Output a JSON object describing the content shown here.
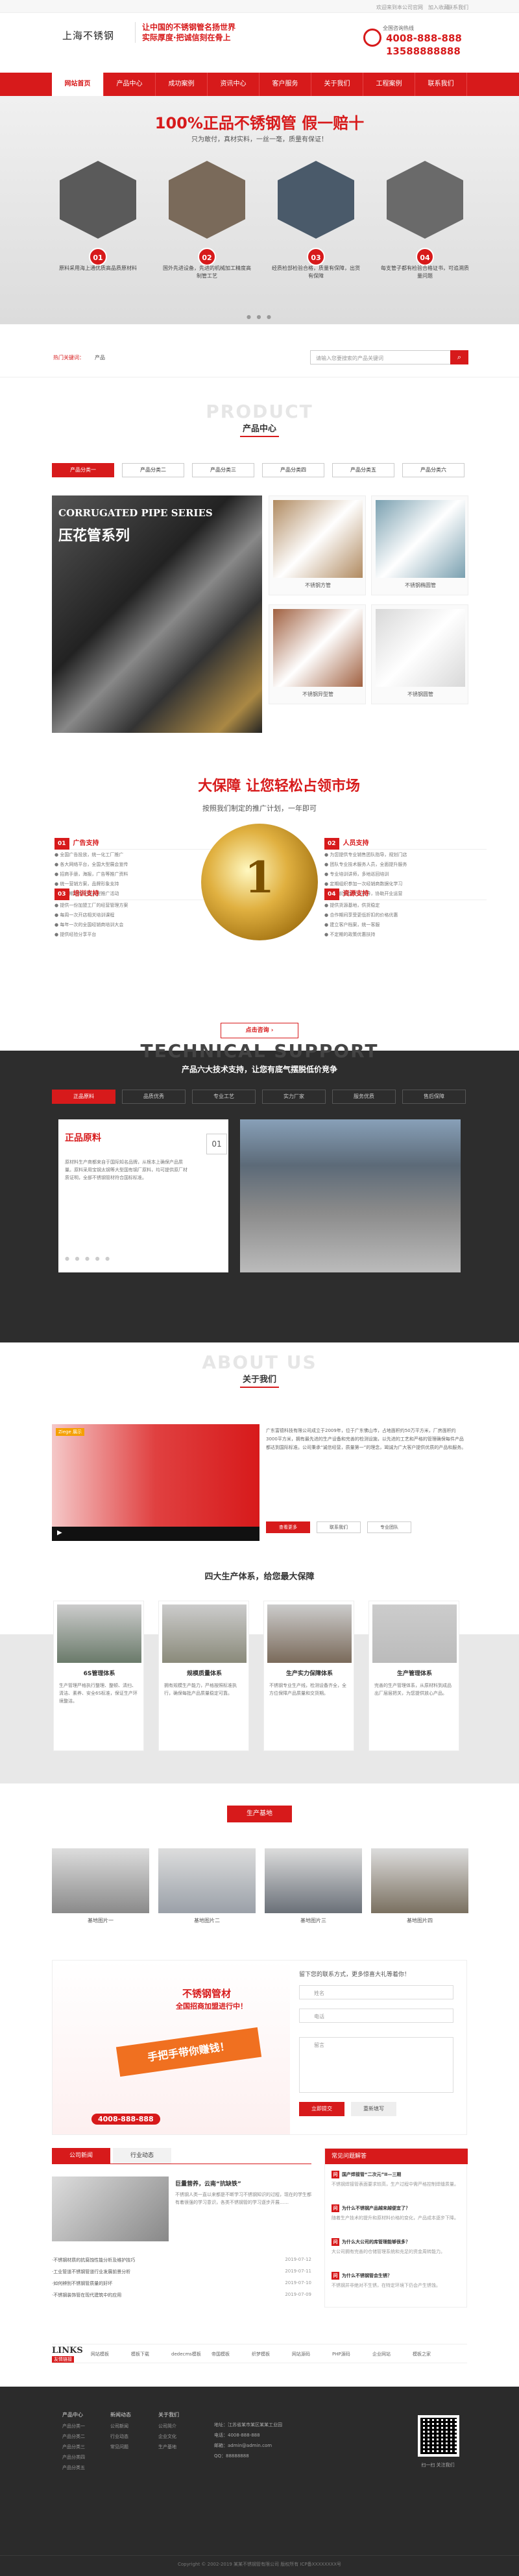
{
  "topbar": {
    "welcome": "欢迎来到本公司官网",
    "collect": "加入收藏",
    "contact": "联系我们"
  },
  "header": {
    "logo": "上海不锈钢",
    "slogan1": "让中国的不锈钢管名扬世界",
    "slogan2": "实际厚度·把诚信刻在骨上",
    "hotline_label": "全国咨询热线",
    "hotline1": "4008-888-888",
    "hotline2": "13588888888"
  },
  "nav": [
    "网站首页",
    "产品中心",
    "成功案例",
    "资讯中心",
    "客户服务",
    "关于我们",
    "工程案例",
    "联系我们"
  ],
  "banner": {
    "title": "100%正品不锈钢管 假一赔十",
    "subtitle": "只为敢付，真材实料，一丝一毫，质量有保证！",
    "items": [
      {
        "num": "01",
        "text": "原料采用海上通优质高品质原材料"
      },
      {
        "num": "02",
        "text": "国外先进设备，先进的机械加工精度高制管工艺"
      },
      {
        "num": "03",
        "text": "经质检部检验合格，质量有保障，出货有保障"
      },
      {
        "num": "04",
        "text": "每支管子都有检验合格证书，可追溯质量问题"
      }
    ],
    "dots": "● ● ●"
  },
  "search": {
    "hot_label": "热门关键词：",
    "hot_item": "产品",
    "placeholder": "请输入您要搜索的产品关键词"
  },
  "products": {
    "en": "PRODUCT",
    "cn": "产品中心",
    "tabs": [
      "产品分类一",
      "产品分类二",
      "产品分类三",
      "产品分类四",
      "产品分类五",
      "产品分类六"
    ],
    "feature_en": "CORRUGATED PIPE SERIES",
    "feature_cn": "压花管系列",
    "thumbs": [
      "不锈钢方管",
      "不锈钢椭圆管",
      "不锈钢异型管",
      "不锈钢圆管"
    ],
    "thumb_colors": [
      "#b08a60",
      "#7aa0b0",
      "#a06040",
      "#d8d8d8"
    ]
  },
  "advantage": {
    "title": "大保障 让您轻松占领市场",
    "subtitle": "按照我们制定的推广计划，一年即可",
    "blocks": [
      {
        "num": "01",
        "head": "广告支持",
        "lines": [
          "全国广告投放，统一化工厂推广",
          "各大网络平台，全国大型展会宣传",
          "招商手册，海报，广告等推广资料",
          "统一营销方案，品牌形象支持",
          "不定期组织全国大型推广活动"
        ]
      },
      {
        "num": "02",
        "head": "人员支持",
        "lines": [
          "为您提供专业销售团队指导，规划门店",
          "团队专业技术服务人员，全面提升服务",
          "专业培训讲师，多地巡回培训",
          "定期组织参加一次经销商数据化学习",
          "开业前后派专人指导，协助开业运营"
        ]
      },
      {
        "num": "03",
        "head": "培训支持",
        "lines": [
          "提供一份加盟工厂的经营管理方案",
          "每周一次开店相关培训课程",
          "每年一次的全国经销商培训大会",
          "提供经验分享平台"
        ]
      },
      {
        "num": "04",
        "head": "资源支持",
        "lines": [
          "提供货源基地，供货稳定",
          "合作期间享受更低折扣的价格优惠",
          "建立客户档案，统一客服",
          "不定期的政策优惠扶持"
        ]
      }
    ],
    "coin_num": "1",
    "button": "点击咨询 ›"
  },
  "tech": {
    "en": "TECHNICAL SUPPORT",
    "cn": "产品六大技术支持，让您有底气摆脱低价竞争",
    "tabs": [
      "正品原料",
      "品质优秀",
      "专业工艺",
      "实力厂家",
      "服务优质",
      "售后保障"
    ],
    "card_title": "正品原料",
    "card_num": "01",
    "card_text": "原材料生产商都来自于国际知名品牌，从根本上确保产品质量。原料采用宝钢太钢等大型国有钢厂原料，均可提供原厂材质证明，全部不锈钢管材符合国标标准。",
    "dots": "● ● ● ● ●"
  },
  "about": {
    "en": "ABOUT US",
    "cn": "关于我们",
    "video_tag": "Ziege 展示",
    "text": "广东富德科技有限公司成立于2009年，位于广东佛山市，占地面积约50万平方米，厂房面积约3000平方米，拥有最先进的生产设备和完善的检测设施，以先进的工艺和严格的管理确保每件产品都达到国际标准。公司秉承“诚信经营，质量第一”的理念，竭诚为广大客户提供优质的产品和服务。",
    "buttons": [
      "查看更多",
      "联系我们",
      "专业团队"
    ],
    "sys_title": "四大生产体系，给您最大保障",
    "sys": [
      {
        "title": "6S管理体系",
        "text": "生产管理严格执行整理、整顿、清扫、清洁、素养、安全6S标准，保证生产环境整洁。"
      },
      {
        "title": "规模质量体系",
        "text": "拥有规模生产能力，严格按照标准执行，确保每批产品质量稳定可靠。"
      },
      {
        "title": "生产实力保障体系",
        "text": "不锈钢专业生产线，检测设备齐全，全方位保障产品质量和交货期。"
      },
      {
        "title": "生产管理体系",
        "text": "完善的生产管理体系，从原材料到成品出厂层层把关，为您提供放心产品。"
      }
    ],
    "sys_colors": [
      "#6a7a6a",
      "#8a8a7a",
      "#7a6a5a",
      "#bbbbbb"
    ]
  },
  "base": {
    "button": "生产基地",
    "items": [
      "基地图片一",
      "基地图片二",
      "基地图片三",
      "基地图片四"
    ],
    "colors": [
      "#8a8a8a",
      "#9aa0a8",
      "#6a7078",
      "#7a7060"
    ]
  },
  "contact": {
    "title1": "不锈钢管材",
    "title2": "全国招商加盟进行中！",
    "banner": "手把手带你赚钱！",
    "phone": "4008-888-888",
    "form_head": "留下您的联系方式，更多惊喜大礼等着你！",
    "name_ph": "姓名",
    "tel_ph": "电话",
    "msg_ph": "留言",
    "submit": "立即提交",
    "reset": "重新填写"
  },
  "news": {
    "tabs": [
      "公司新闻",
      "行业动态"
    ],
    "feature_title": "巨量营养，云南“抗缺铁”",
    "feature_text": "不锈钢人类一直以来都是不断学习不锈钢知识的过程，现在的学生都有着很强的学习意识，各类不锈钢管的学习逐步开展……",
    "items": [
      {
        "text": "·不锈钢材质的抗腐蚀性能分析及维护技巧",
        "date": "2019-07-12"
      },
      {
        "text": "·工业管道不锈钢管道行业发展前景分析",
        "date": "2019-07-11"
      },
      {
        "text": "·如何辨别不锈钢管质量的好坏",
        "date": "2019-07-10"
      },
      {
        "text": "·不锈钢装饰管在现代建筑中的应用",
        "date": "2019-07-09"
      }
    ],
    "faq_head": "常见问题解答",
    "faq": [
      {
        "q": "国产焊接管“二次元”II—三期",
        "a": "不锈钢焊接管表面要求较高，生产过程中需严格控制焊缝质量。"
      },
      {
        "q": "为什么不锈钢产品越来越便宜了？",
        "a": "随着生产技术的提升和原材料价格的变化，产品成本逐步下降。"
      },
      {
        "q": "为什么大公司的库管理能够很多？",
        "a": "大公司拥有完善的仓储管理系统和充足的资金周转能力。"
      },
      {
        "q": "为什么不锈钢管会生锈？",
        "a": "不锈钢并非绝对不生锈，在特定环境下仍会产生锈蚀。"
      }
    ]
  },
  "links": {
    "label": "LINKS",
    "cn": "友情链接",
    "items": [
      "网站模板",
      "模板下载",
      "dedecms模板",
      "帝国模板",
      "织梦模板",
      "网站源码",
      "PHP源码",
      "企业网站",
      "模板之家"
    ]
  },
  "footer": {
    "cols": [
      {
        "head": "产品中心",
        "items": [
          "产品分类一",
          "产品分类二",
          "产品分类三",
          "产品分类四",
          "产品分类五"
        ]
      },
      {
        "head": "新闻动态",
        "items": [
          "公司新闻",
          "行业动态",
          "常见问题"
        ]
      },
      {
        "head": "关于我们",
        "items": [
          "公司简介",
          "企业文化",
          "生产基地"
        ]
      }
    ],
    "address": "地址：江苏省某市某区某某工业园",
    "tel": "电话：4008-888-888",
    "email": "邮箱：admin@admin.com",
    "qq": "QQ：88888888",
    "qr_caption": "扫一扫 关注我们",
    "copyright": "Copyright © 2002-2019 某某不锈钢管有限公司 版权所有 ICP备XXXXXXXX号"
  }
}
